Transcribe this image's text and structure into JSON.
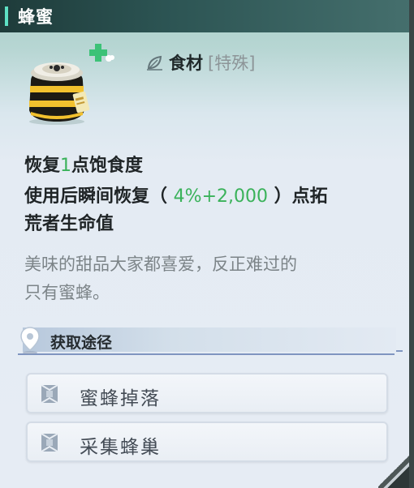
{
  "item": {
    "name": "蜂蜜",
    "category_main": "食材",
    "category_sub": "[特殊]"
  },
  "effects": {
    "line1_prefix": "恢复",
    "line1_value": "1",
    "line1_suffix": "点饱食度",
    "line2_prefix": "使用后瞬间恢复（ ",
    "line2_value": "4%+2,000",
    "line2_suffix": " ）点拓",
    "line3": "荒者生命值"
  },
  "flavor": {
    "line1": "美味的甜品大家都喜爱，反正难过的",
    "line2": "只有蜜蜂。"
  },
  "acquire": {
    "title": "获取途径",
    "sources": [
      {
        "label": "蜜蜂掉落"
      },
      {
        "label": "采集蜂巢"
      }
    ]
  },
  "colors": {
    "accent": "#5ee0c4",
    "effect_value": "#3ab25a",
    "title_bar": "#2c5453"
  },
  "icons": {
    "item": "honey-jar-icon",
    "badge": "health-plus-icon",
    "category": "leaf-icon",
    "acquire": "location-pin-icon",
    "source": "source-tag-icon"
  }
}
